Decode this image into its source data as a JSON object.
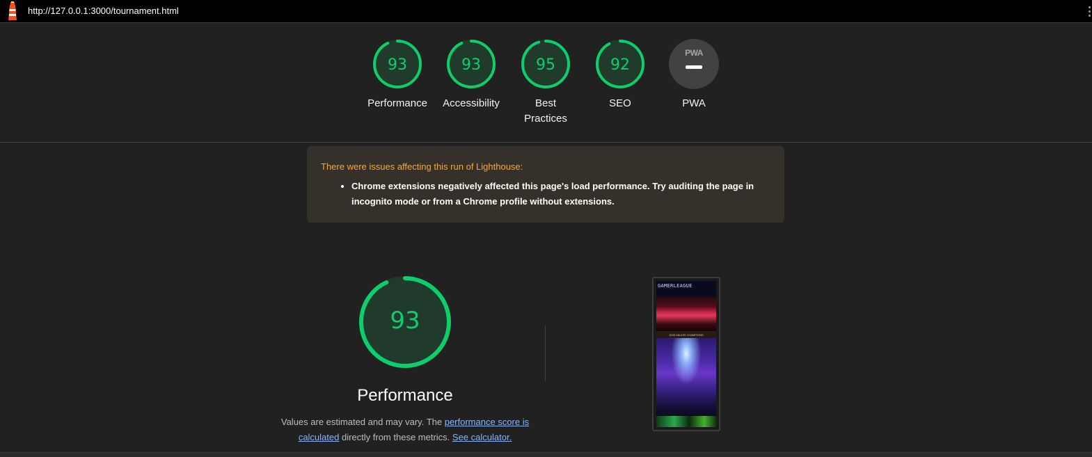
{
  "browser": {
    "url": "http://127.0.0.1:3000/tournament.html"
  },
  "colors": {
    "pass": "#0cce6b",
    "pass_fill": "#1e3a2a",
    "warning_title": "#ffa726",
    "link": "#8ab4f8"
  },
  "gauges": [
    {
      "label": "Performance",
      "score": "93",
      "value": 0.93
    },
    {
      "label": "Accessibility",
      "score": "93",
      "value": 0.93
    },
    {
      "label": "Best Practices",
      "score": "95",
      "value": 0.95
    },
    {
      "label": "SEO",
      "score": "92",
      "value": 0.92
    }
  ],
  "pwa": {
    "badge_text": "PWA",
    "label": "PWA",
    "icon": "pwa-dash-icon"
  },
  "warning": {
    "title": "There were issues affecting this run of Lighthouse:",
    "items": [
      "Chrome extensions negatively affected this page's load performance. Try auditing the page in incognito mode or from a Chrome profile without extensions."
    ]
  },
  "performance": {
    "score": "93",
    "value": 0.93,
    "title": "Performance",
    "desc_prefix": "Values are estimated and may vary. The ",
    "desc_link1": "performance score is calculated",
    "desc_middle": " directly from these metrics. ",
    "desc_link2": "See calculator."
  },
  "thumbnail": {
    "brand": "GAMERLEAGUE",
    "strip_text": "2025 MAJOR CHAMPIONS"
  }
}
